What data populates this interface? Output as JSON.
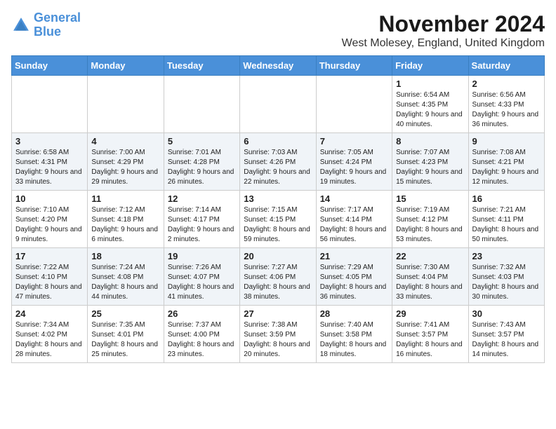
{
  "logo": {
    "line1": "General",
    "line2": "Blue"
  },
  "title": "November 2024",
  "location": "West Molesey, England, United Kingdom",
  "weekdays": [
    "Sunday",
    "Monday",
    "Tuesday",
    "Wednesday",
    "Thursday",
    "Friday",
    "Saturday"
  ],
  "weeks": [
    [
      {
        "day": "",
        "sunrise": "",
        "sunset": "",
        "daylight": ""
      },
      {
        "day": "",
        "sunrise": "",
        "sunset": "",
        "daylight": ""
      },
      {
        "day": "",
        "sunrise": "",
        "sunset": "",
        "daylight": ""
      },
      {
        "day": "",
        "sunrise": "",
        "sunset": "",
        "daylight": ""
      },
      {
        "day": "",
        "sunrise": "",
        "sunset": "",
        "daylight": ""
      },
      {
        "day": "1",
        "sunrise": "Sunrise: 6:54 AM",
        "sunset": "Sunset: 4:35 PM",
        "daylight": "Daylight: 9 hours and 40 minutes."
      },
      {
        "day": "2",
        "sunrise": "Sunrise: 6:56 AM",
        "sunset": "Sunset: 4:33 PM",
        "daylight": "Daylight: 9 hours and 36 minutes."
      }
    ],
    [
      {
        "day": "3",
        "sunrise": "Sunrise: 6:58 AM",
        "sunset": "Sunset: 4:31 PM",
        "daylight": "Daylight: 9 hours and 33 minutes."
      },
      {
        "day": "4",
        "sunrise": "Sunrise: 7:00 AM",
        "sunset": "Sunset: 4:29 PM",
        "daylight": "Daylight: 9 hours and 29 minutes."
      },
      {
        "day": "5",
        "sunrise": "Sunrise: 7:01 AM",
        "sunset": "Sunset: 4:28 PM",
        "daylight": "Daylight: 9 hours and 26 minutes."
      },
      {
        "day": "6",
        "sunrise": "Sunrise: 7:03 AM",
        "sunset": "Sunset: 4:26 PM",
        "daylight": "Daylight: 9 hours and 22 minutes."
      },
      {
        "day": "7",
        "sunrise": "Sunrise: 7:05 AM",
        "sunset": "Sunset: 4:24 PM",
        "daylight": "Daylight: 9 hours and 19 minutes."
      },
      {
        "day": "8",
        "sunrise": "Sunrise: 7:07 AM",
        "sunset": "Sunset: 4:23 PM",
        "daylight": "Daylight: 9 hours and 15 minutes."
      },
      {
        "day": "9",
        "sunrise": "Sunrise: 7:08 AM",
        "sunset": "Sunset: 4:21 PM",
        "daylight": "Daylight: 9 hours and 12 minutes."
      }
    ],
    [
      {
        "day": "10",
        "sunrise": "Sunrise: 7:10 AM",
        "sunset": "Sunset: 4:20 PM",
        "daylight": "Daylight: 9 hours and 9 minutes."
      },
      {
        "day": "11",
        "sunrise": "Sunrise: 7:12 AM",
        "sunset": "Sunset: 4:18 PM",
        "daylight": "Daylight: 9 hours and 6 minutes."
      },
      {
        "day": "12",
        "sunrise": "Sunrise: 7:14 AM",
        "sunset": "Sunset: 4:17 PM",
        "daylight": "Daylight: 9 hours and 2 minutes."
      },
      {
        "day": "13",
        "sunrise": "Sunrise: 7:15 AM",
        "sunset": "Sunset: 4:15 PM",
        "daylight": "Daylight: 8 hours and 59 minutes."
      },
      {
        "day": "14",
        "sunrise": "Sunrise: 7:17 AM",
        "sunset": "Sunset: 4:14 PM",
        "daylight": "Daylight: 8 hours and 56 minutes."
      },
      {
        "day": "15",
        "sunrise": "Sunrise: 7:19 AM",
        "sunset": "Sunset: 4:12 PM",
        "daylight": "Daylight: 8 hours and 53 minutes."
      },
      {
        "day": "16",
        "sunrise": "Sunrise: 7:21 AM",
        "sunset": "Sunset: 4:11 PM",
        "daylight": "Daylight: 8 hours and 50 minutes."
      }
    ],
    [
      {
        "day": "17",
        "sunrise": "Sunrise: 7:22 AM",
        "sunset": "Sunset: 4:10 PM",
        "daylight": "Daylight: 8 hours and 47 minutes."
      },
      {
        "day": "18",
        "sunrise": "Sunrise: 7:24 AM",
        "sunset": "Sunset: 4:08 PM",
        "daylight": "Daylight: 8 hours and 44 minutes."
      },
      {
        "day": "19",
        "sunrise": "Sunrise: 7:26 AM",
        "sunset": "Sunset: 4:07 PM",
        "daylight": "Daylight: 8 hours and 41 minutes."
      },
      {
        "day": "20",
        "sunrise": "Sunrise: 7:27 AM",
        "sunset": "Sunset: 4:06 PM",
        "daylight": "Daylight: 8 hours and 38 minutes."
      },
      {
        "day": "21",
        "sunrise": "Sunrise: 7:29 AM",
        "sunset": "Sunset: 4:05 PM",
        "daylight": "Daylight: 8 hours and 36 minutes."
      },
      {
        "day": "22",
        "sunrise": "Sunrise: 7:30 AM",
        "sunset": "Sunset: 4:04 PM",
        "daylight": "Daylight: 8 hours and 33 minutes."
      },
      {
        "day": "23",
        "sunrise": "Sunrise: 7:32 AM",
        "sunset": "Sunset: 4:03 PM",
        "daylight": "Daylight: 8 hours and 30 minutes."
      }
    ],
    [
      {
        "day": "24",
        "sunrise": "Sunrise: 7:34 AM",
        "sunset": "Sunset: 4:02 PM",
        "daylight": "Daylight: 8 hours and 28 minutes."
      },
      {
        "day": "25",
        "sunrise": "Sunrise: 7:35 AM",
        "sunset": "Sunset: 4:01 PM",
        "daylight": "Daylight: 8 hours and 25 minutes."
      },
      {
        "day": "26",
        "sunrise": "Sunrise: 7:37 AM",
        "sunset": "Sunset: 4:00 PM",
        "daylight": "Daylight: 8 hours and 23 minutes."
      },
      {
        "day": "27",
        "sunrise": "Sunrise: 7:38 AM",
        "sunset": "Sunset: 3:59 PM",
        "daylight": "Daylight: 8 hours and 20 minutes."
      },
      {
        "day": "28",
        "sunrise": "Sunrise: 7:40 AM",
        "sunset": "Sunset: 3:58 PM",
        "daylight": "Daylight: 8 hours and 18 minutes."
      },
      {
        "day": "29",
        "sunrise": "Sunrise: 7:41 AM",
        "sunset": "Sunset: 3:57 PM",
        "daylight": "Daylight: 8 hours and 16 minutes."
      },
      {
        "day": "30",
        "sunrise": "Sunrise: 7:43 AM",
        "sunset": "Sunset: 3:57 PM",
        "daylight": "Daylight: 8 hours and 14 minutes."
      }
    ]
  ]
}
